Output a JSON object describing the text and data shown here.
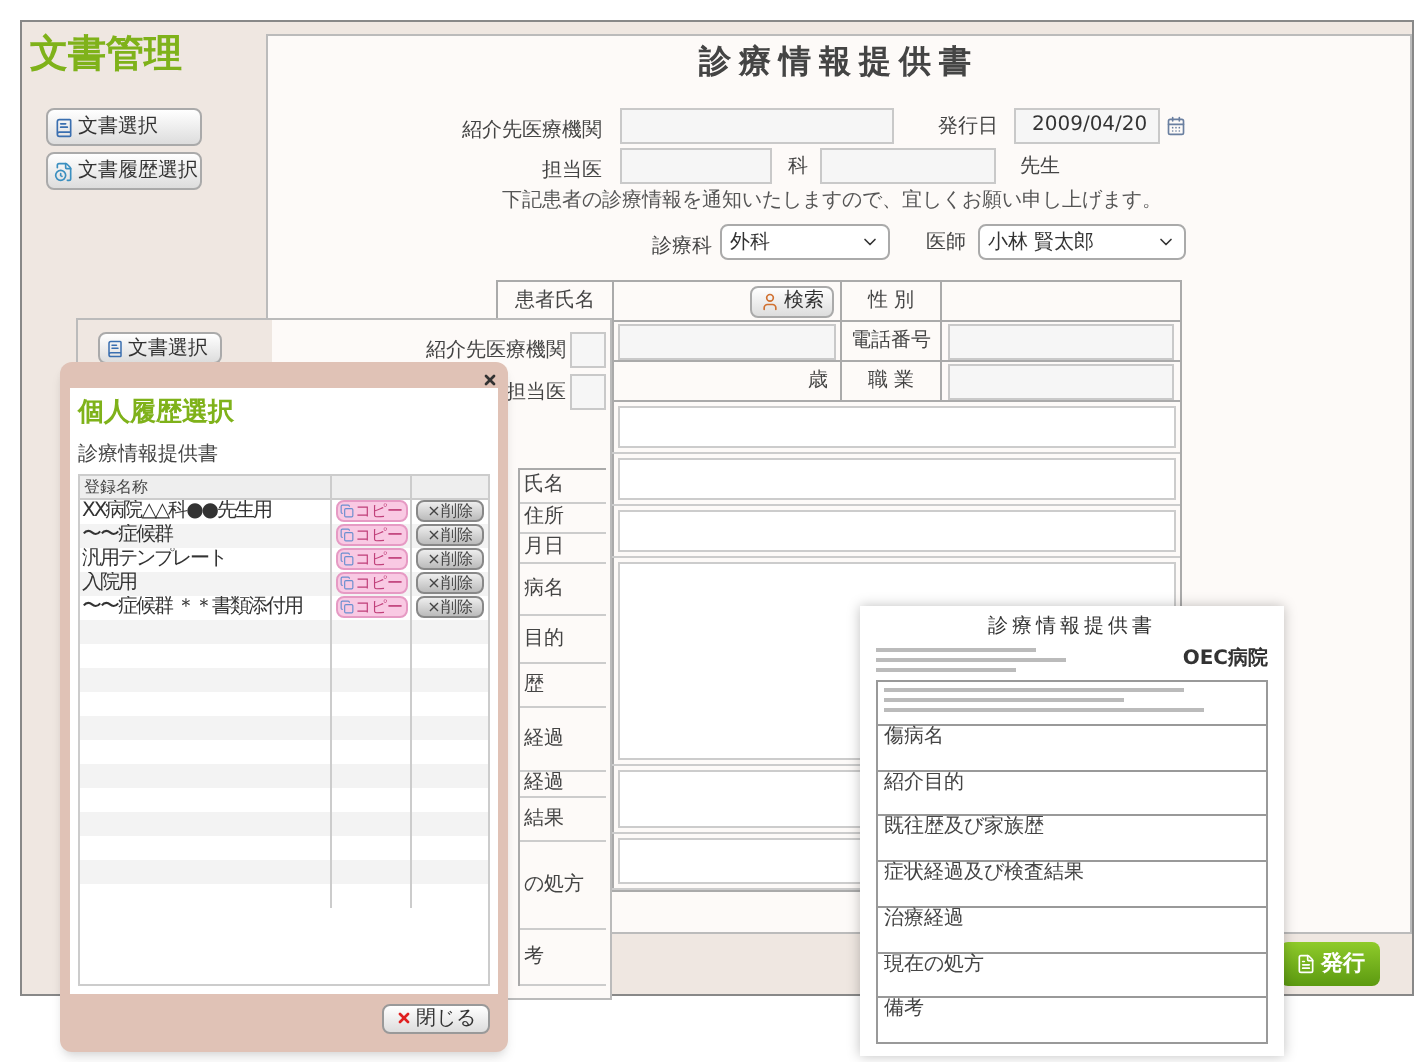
{
  "app_title": "文書管理",
  "sidebar_buttons": [
    {
      "label": "文書選択",
      "kind": "select"
    },
    {
      "label": "文書履歴選択",
      "kind": "history"
    }
  ],
  "form": {
    "title": "診療情報提供書",
    "referral_label": "紹介先医療機関",
    "issue_date_label": "発行日",
    "issue_date": "2009/04/20",
    "doctor_label": "担当医",
    "department_label": "科",
    "honorific": "先生",
    "notice": "下記患者の診療情報を通知いたしますので、宜しくお願い申し上げます。",
    "specialty_label": "診療科",
    "specialty": "外科",
    "physician_label": "医師",
    "physician": "小林 賢太郎",
    "patient": {
      "name_label": "患者氏名",
      "search_button": "検索",
      "sex_label": "性 別",
      "phone_label": "電話番号",
      "age_suffix": "歳",
      "occupation_label": "職 業"
    }
  },
  "issue_button": "発行",
  "background_window": {
    "sidebar_button": "文書選択",
    "referral_label": "紹介先医療機関",
    "doctor_label": "担当医",
    "row_labels": [
      "氏名",
      "住所",
      "月日",
      "病名",
      "目的",
      "歴",
      "経過",
      "経過",
      "結果",
      "の処方",
      "考"
    ]
  },
  "dialog": {
    "title": "個人履歴選択",
    "subtitle": "診療情報提供書",
    "column_1": "登録名称",
    "rows": [
      {
        "name": "XX病院△△科●●先生用",
        "copy": "コピー",
        "delete": "×削除"
      },
      {
        "name": "〜〜症候群",
        "copy": "コピー",
        "delete": "×削除"
      },
      {
        "name": "汎用テンプレート",
        "copy": "コピー",
        "delete": "×削除"
      },
      {
        "name": "入院用",
        "copy": "コピー",
        "delete": "×削除"
      },
      {
        "name": "〜〜症候群 ＊＊書類添付用",
        "copy": "コピー",
        "delete": "×削除"
      }
    ],
    "close_button": "閉じる"
  },
  "document_preview": {
    "title": "診療情報提供書",
    "hospital": "OEC病院",
    "sections": [
      "傷病名",
      "紹介目的",
      "既往歴及び家族歴",
      "症状経過及び検査結果",
      "治療経過",
      "現在の処方",
      "備考"
    ]
  }
}
